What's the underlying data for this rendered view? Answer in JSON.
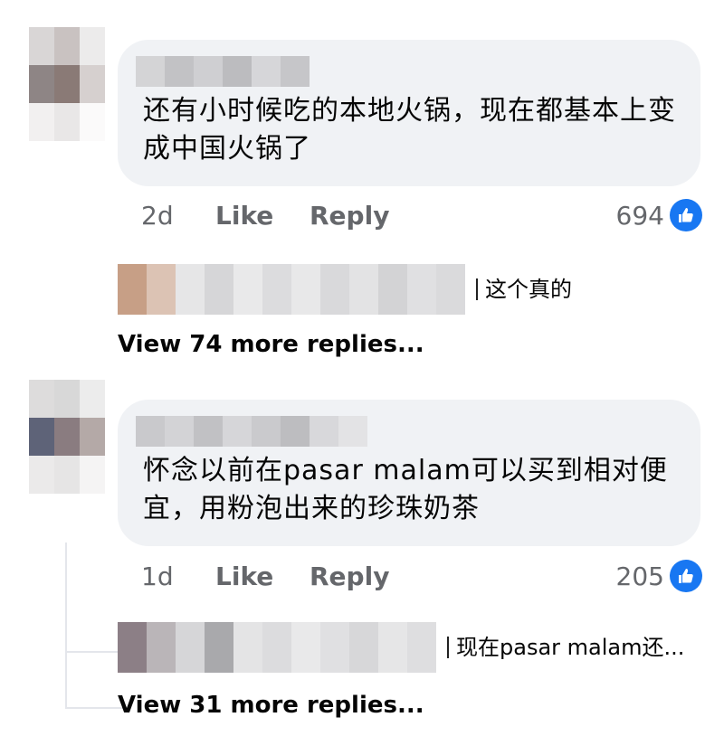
{
  "comments": [
    {
      "text": "还有小时候吃的本地火锅，现在都基本上变成中国火锅了",
      "time": "2d",
      "like_label": "Like",
      "reply_label": "Reply",
      "reaction_count": "694",
      "reply_preview": "这个真的",
      "view_more": "View 74 more replies..."
    },
    {
      "text": "怀念以前在pasar malam可以买到相对便宜，用粉泡出来的珍珠奶茶",
      "time": "1d",
      "like_label": "Like",
      "reply_label": "Reply",
      "reaction_count": "205",
      "reply_preview": "现在pasar malam还...",
      "view_more": "View 31 more replies..."
    }
  ],
  "colors": {
    "bubble_bg": "#f0f2f5",
    "meta_text": "#65676b",
    "like_blue": "#1877f2"
  },
  "icons": {
    "reaction": "thumbs-up-icon"
  }
}
